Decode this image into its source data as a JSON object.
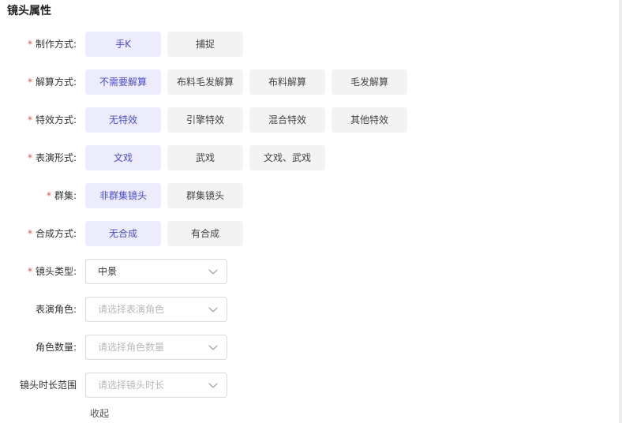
{
  "section_title": "镜头属性",
  "required_mark": "*",
  "rows": {
    "production_method": {
      "label": "制作方式:",
      "options": [
        "手K",
        "捕捉"
      ],
      "selected": "手K"
    },
    "solve_method": {
      "label": "解算方式:",
      "options": [
        "不需要解算",
        "布料毛发解算",
        "布料解算",
        "毛发解算"
      ],
      "selected": "不需要解算"
    },
    "effects_method": {
      "label": "特效方式:",
      "options": [
        "无特效",
        "引擎特效",
        "混合特效",
        "其他特效"
      ],
      "selected": "无特效"
    },
    "performance_form": {
      "label": "表演形式:",
      "options": [
        "文戏",
        "武戏",
        "文戏、武戏"
      ],
      "selected": "文戏"
    },
    "crowd": {
      "label": "群集:",
      "options": [
        "非群集镜头",
        "群集镜头"
      ],
      "selected": "非群集镜头"
    },
    "compositing_method": {
      "label": "合成方式:",
      "options": [
        "无合成",
        "有合成"
      ],
      "selected": "无合成"
    }
  },
  "selects": {
    "shot_type": {
      "label": "镜头类型:",
      "required": true,
      "value": "中景",
      "placeholder": ""
    },
    "performance_role": {
      "label": "表演角色:",
      "required": false,
      "value": "",
      "placeholder": "请选择表演角色"
    },
    "role_count": {
      "label": "角色数量:",
      "required": false,
      "value": "",
      "placeholder": "请选择角色数量"
    },
    "shot_duration": {
      "label": "镜头时长范围",
      "required": false,
      "value": "",
      "placeholder": "请选择镜头时长"
    }
  },
  "collapse_label": "收起",
  "colors": {
    "accent": "#4b4dd1",
    "selected_bg": "#ececfc",
    "option_bg": "#f3f3f4",
    "required": "#e5484d"
  },
  "icons": {
    "dropdown": "chevron-down-icon"
  }
}
